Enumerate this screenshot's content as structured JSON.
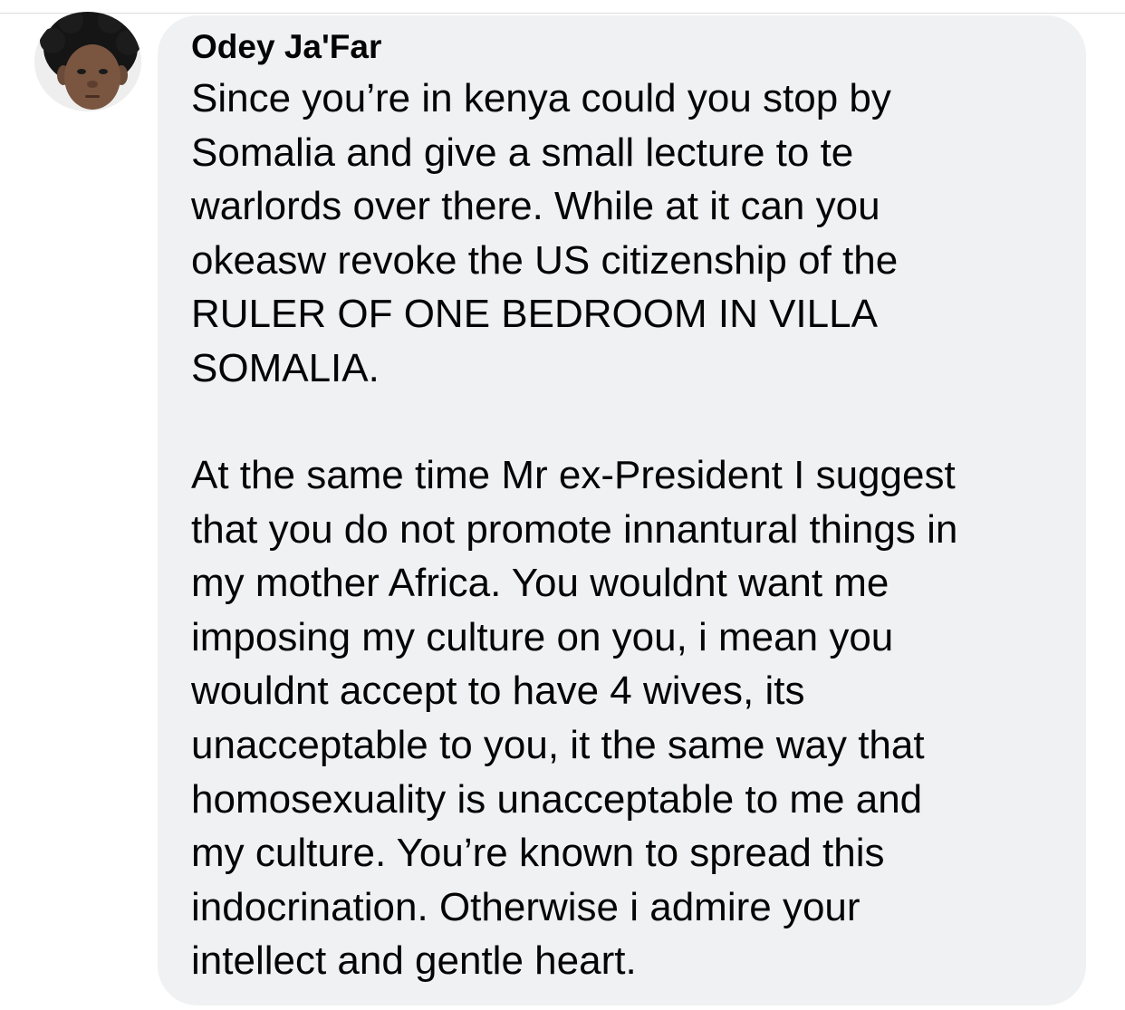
{
  "comment": {
    "author": "Odey Ja'Far",
    "paragraphs": [
      [
        "Since you’re in kenya could you stop by",
        "Somalia and give a small lecture to te",
        "warlords over there. While at it can you",
        "okeasw revoke the US citizenship of the",
        "RULER OF ONE BEDROOM IN VILLA",
        "SOMALIA."
      ],
      [
        "At the same time Mr ex-President I suggest",
        "that you do not promote innantural things in",
        "my mother Africa. You wouldnt want me",
        "imposing my culture on you, i mean you",
        "wouldnt accept to have 4 wives, its",
        "unacceptable to you, it the same way that",
        "homosexuality is unacceptable to me and",
        "my culture. You’re known to spread this",
        "indocrination. Otherwise i admire your",
        "intellect and gentle heart."
      ]
    ]
  },
  "colors": {
    "bubble_background": "#f0f1f3",
    "text": "#050505",
    "divider": "#dcdde1"
  }
}
